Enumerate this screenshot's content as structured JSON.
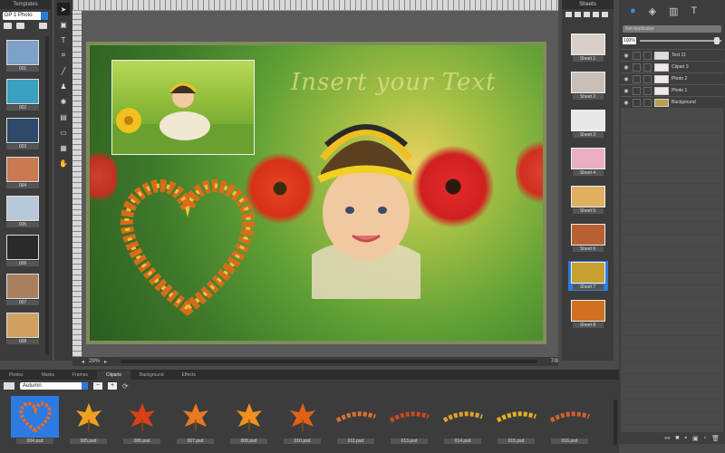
{
  "templates": {
    "header": "Templates",
    "dropdown": "DP 1 Photo",
    "items": [
      {
        "label": "001",
        "color": "#7fa0c8"
      },
      {
        "label": "002",
        "color": "#3aa0c0"
      },
      {
        "label": "003",
        "color": "#2d4a6a"
      },
      {
        "label": "004",
        "color": "#c87a50"
      },
      {
        "label": "005",
        "color": "#b8c8d8"
      },
      {
        "label": "006",
        "color": "#2a2a2a"
      },
      {
        "label": "007",
        "color": "#a88060"
      },
      {
        "label": "008",
        "color": "#d0a060"
      }
    ]
  },
  "canvas": {
    "overlay_text": "Insert your Text",
    "zoom": "29%",
    "page_indicator": "7/8"
  },
  "sheets": {
    "header": "Sheets",
    "items": [
      {
        "label": "Sheet 1",
        "color": "#d8d0c8",
        "active": false
      },
      {
        "label": "Sheet 2",
        "color": "#c8c0b8",
        "active": false
      },
      {
        "label": "Sheet 3",
        "color": "#e8e8e8",
        "active": false
      },
      {
        "label": "Sheet 4",
        "color": "#e8b0c0",
        "active": false
      },
      {
        "label": "Sheet 5",
        "color": "#e0b060",
        "active": false
      },
      {
        "label": "Sheet 6",
        "color": "#b86030",
        "active": false
      },
      {
        "label": "Sheet 7",
        "color": "#c8a030",
        "active": true
      },
      {
        "label": "Sheet 8",
        "color": "#d07020",
        "active": false
      }
    ]
  },
  "layers": {
    "blend_mode": "Not Applicable",
    "opacity": "100%",
    "items": [
      {
        "name": "Text 11",
        "thumb": "#dddddd"
      },
      {
        "name": "Clipart 3",
        "thumb": "#f0e8e8"
      },
      {
        "name": "Photo 2",
        "thumb": "#f0e8e8"
      },
      {
        "name": "Photo 1",
        "thumb": "#f0e8e8"
      },
      {
        "name": "Background",
        "thumb": "#b8a050"
      }
    ]
  },
  "bottom": {
    "tabs": [
      "Photos",
      "Masks",
      "Frames",
      "Cliparts",
      "Background",
      "Effects"
    ],
    "active_tab": "Cliparts",
    "category": "Autumn",
    "items": [
      {
        "label": "004.psd",
        "active": true
      },
      {
        "label": "005.psd",
        "active": false
      },
      {
        "label": "006.psd",
        "active": false
      },
      {
        "label": "007.psd",
        "active": false
      },
      {
        "label": "008.psd",
        "active": false
      },
      {
        "label": "010.psd",
        "active": false
      },
      {
        "label": "011.psd",
        "active": false
      },
      {
        "label": "013.psd",
        "active": false
      },
      {
        "label": "014.psd",
        "active": false
      },
      {
        "label": "015.psd",
        "active": false
      },
      {
        "label": "016.psd",
        "active": false
      }
    ]
  }
}
